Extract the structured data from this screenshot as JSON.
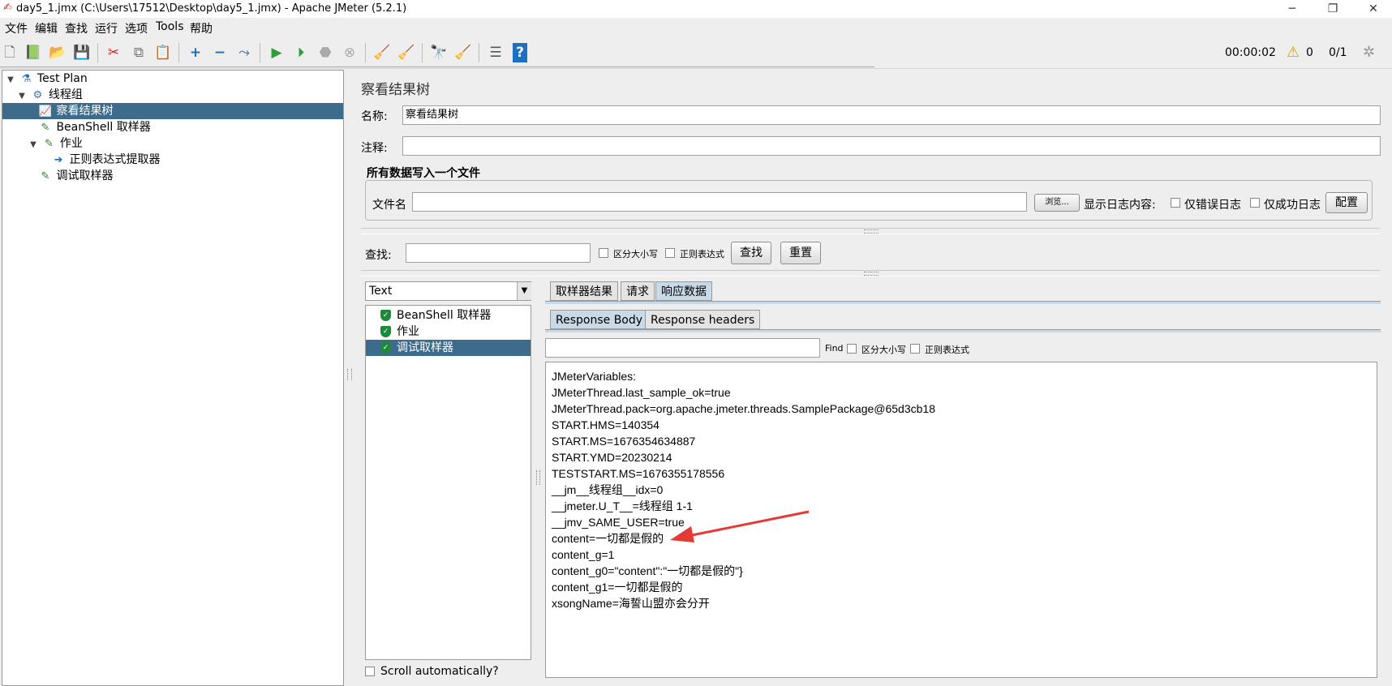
{
  "window": {
    "title": "day5_1.jmx (C:\\Users\\17512\\Desktop\\day5_1.jmx) - Apache JMeter (5.2.1)",
    "minimize": "─",
    "restore": "❐",
    "close": "✕"
  },
  "menu": [
    "文件",
    "编辑",
    "查找",
    "运行",
    "选项",
    "Tools",
    "帮助"
  ],
  "status": {
    "elapsed": "00:00:02",
    "warnings": "0",
    "threads": "0/1"
  },
  "tree": [
    {
      "label": "Test Plan",
      "toggle": "▼",
      "icon": "test-plan-icon",
      "glyph": "⚗"
    },
    {
      "label": "线程组",
      "toggle": "▼",
      "icon": "thread-group-icon",
      "glyph": "⚙"
    },
    {
      "label": "察看结果树",
      "toggle": "",
      "icon": "result-tree-icon",
      "glyph": "📈"
    },
    {
      "label": "BeanShell 取样器",
      "toggle": "",
      "icon": "sampler-icon",
      "glyph": "✎"
    },
    {
      "label": "作业",
      "toggle": "▼",
      "icon": "sampler-icon",
      "glyph": "✎"
    },
    {
      "label": "正则表达式提取器",
      "toggle": "",
      "icon": "extractor-icon",
      "glyph": "➜"
    },
    {
      "label": "调试取样器",
      "toggle": "",
      "icon": "sampler-icon",
      "glyph": "✎"
    }
  ],
  "panel": {
    "title": "察看结果树",
    "name_label": "名称:",
    "name_value": "察看结果树",
    "comment_label": "注释:",
    "comment_value": "",
    "file_section": "所有数据写入一个文件",
    "filename_label": "文件名",
    "filename_value": "",
    "browse": "浏览...",
    "log_label": "显示日志内容:",
    "errors_only": "仅错误日志",
    "success_only": "仅成功日志",
    "configure": "配置"
  },
  "search": {
    "label": "查找:",
    "value": "",
    "case": "区分大小写",
    "regex": "正则表达式",
    "find_btn": "查找",
    "reset_btn": "重置"
  },
  "renderer": {
    "selected": "Text",
    "arrow": "▼"
  },
  "samples": [
    "BeanShell 取样器",
    "作业",
    "调试取样器"
  ],
  "scroll_auto": "Scroll automatically?",
  "tabs": [
    "取样器结果",
    "请求",
    "响应数据"
  ],
  "subtabs": [
    "Response Body",
    "Response headers"
  ],
  "find": {
    "value": "",
    "label": "Find",
    "case": "区分大小写",
    "regex": "正则表达式"
  },
  "response_lines": [
    "JMeterVariables:",
    "JMeterThread.last_sample_ok=true",
    "JMeterThread.pack=org.apache.jmeter.threads.SamplePackage@65d3cb18",
    "START.HMS=140354",
    "START.MS=1676354634887",
    "START.YMD=20230214",
    "TESTSTART.MS=1676355178556",
    "__jm__线程组__idx=0",
    "__jmeter.U_T__=线程组 1-1",
    "__jmv_SAME_USER=true",
    "content=一切都是假的",
    "content_g=1",
    "content_g0=\"content\":\"一切都是假的\"}",
    "content_g1=一切都是假的",
    "xsongName=海誓山盟亦会分开"
  ],
  "colors": {
    "selection": "#3c6b8c",
    "annotation_arrow": "#e53935",
    "active_tab": "#c8d9e8"
  }
}
